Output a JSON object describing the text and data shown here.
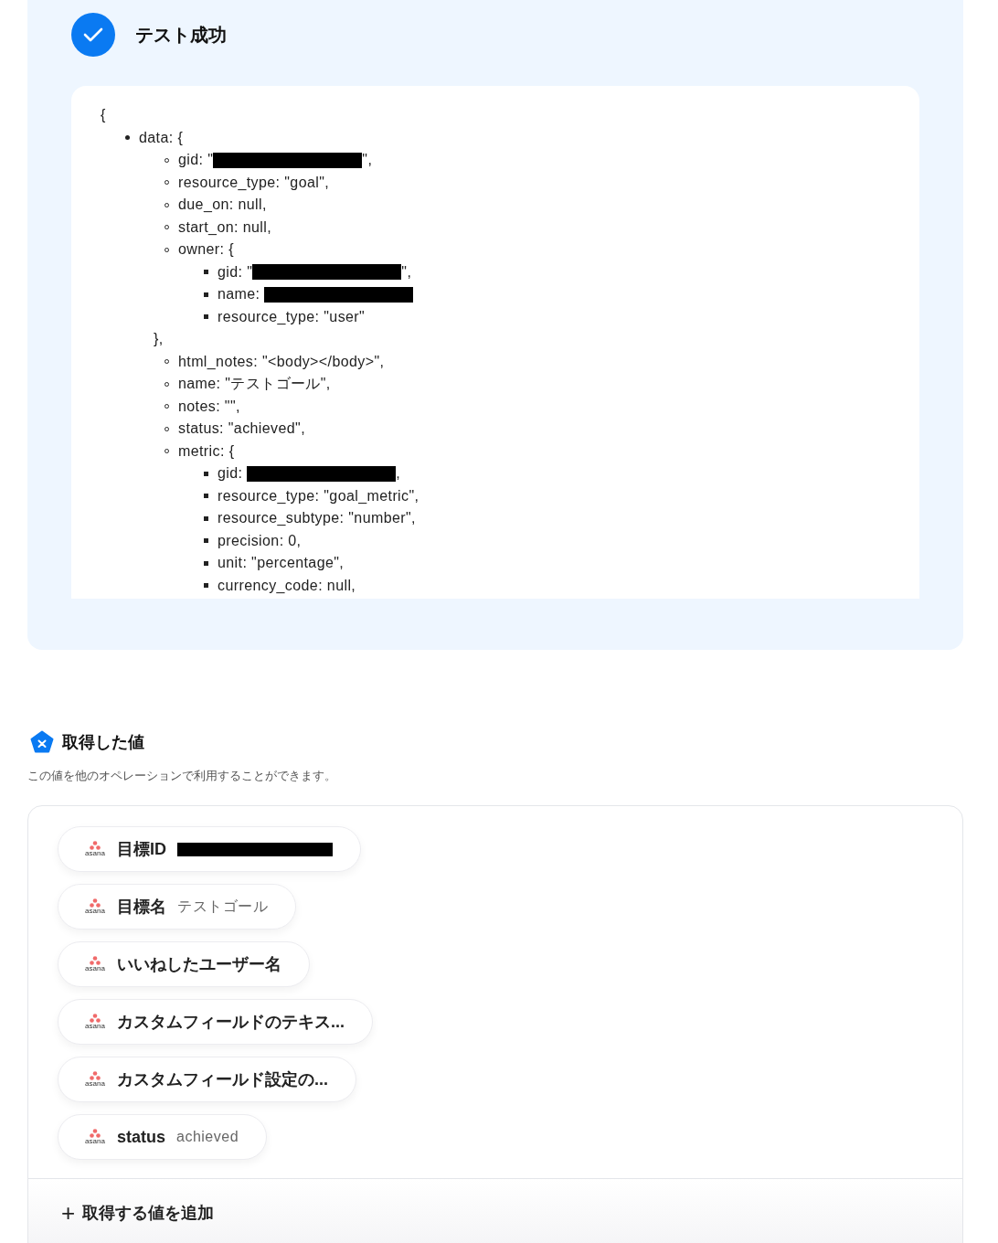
{
  "test_result": {
    "title": "テスト成功",
    "success": true,
    "response": {
      "open": "{",
      "items": [
        {
          "text": "data: {",
          "children": [
            {
              "text": "gid: \"",
              "redacted": true,
              "after": "\","
            },
            {
              "text": "resource_type: \"goal\","
            },
            {
              "text": "due_on: null,"
            },
            {
              "text": "start_on: null,"
            },
            {
              "text": "owner: {",
              "closing": "},",
              "children": [
                {
                  "text": "gid: \"",
                  "redacted": true,
                  "after": "\","
                },
                {
                  "text": "name: ",
                  "redacted": true
                },
                {
                  "text": "resource_type: \"user\""
                }
              ]
            },
            {
              "text": "html_notes: \"<body></body>\","
            },
            {
              "text": "name: \"テストゴール\","
            },
            {
              "text": "notes: \"\","
            },
            {
              "text": "status: \"achieved\","
            },
            {
              "text": "metric: {",
              "children": [
                {
                  "text": "gid: ",
                  "redacted": true,
                  "after": ","
                },
                {
                  "text": "resource_type: \"goal_metric\","
                },
                {
                  "text": "resource_subtype: \"number\","
                },
                {
                  "text": "precision: 0,"
                },
                {
                  "text": "unit: \"percentage\","
                },
                {
                  "text": "currency_code: null,"
                }
              ]
            }
          ]
        }
      ]
    }
  },
  "retrieved_values": {
    "title": "取得した値",
    "description": "この値を他のオペレーションで利用することができます。",
    "items": [
      {
        "source": "asana",
        "label": "目標ID",
        "redacted": true
      },
      {
        "source": "asana",
        "label": "目標名",
        "value": "テストゴール"
      },
      {
        "source": "asana",
        "label": "いいねしたユーザー名"
      },
      {
        "source": "asana",
        "label": "カスタムフィールドのテキス..."
      },
      {
        "source": "asana",
        "label": "カスタムフィールド設定の..."
      },
      {
        "source": "asana",
        "label": "status",
        "value": "achieved"
      }
    ],
    "add_button": {
      "icon": "+",
      "label": "取得する値を追加"
    }
  }
}
